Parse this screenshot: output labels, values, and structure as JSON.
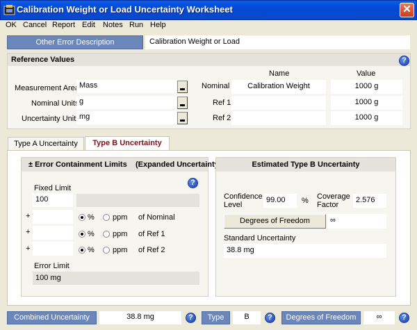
{
  "window": {
    "title": "Calibration Weight or Load Uncertainty Worksheet",
    "close_glyph": "✕"
  },
  "menu": [
    "OK",
    "Cancel",
    "Report",
    "Edit",
    "Notes",
    "Run",
    "Help"
  ],
  "error_desc": {
    "button": "Other Error Description",
    "value": "Calibration Weight or Load"
  },
  "reference": {
    "heading": "Reference Values",
    "col_name": "Name",
    "col_value": "Value",
    "rows": [
      {
        "label": "Measurement Area",
        "value": "Mass",
        "ref_label": "Nominal",
        "name": "Calibration Weight",
        "ref_value": "1000 g"
      },
      {
        "label": "Nominal Units",
        "value": "g",
        "ref_label": "Ref 1",
        "name": "",
        "ref_value": "1000 g"
      },
      {
        "label": "Uncertainty Units",
        "value": "mg",
        "ref_label": "Ref 2",
        "name": "",
        "ref_value": "1000 g"
      }
    ]
  },
  "tabs": [
    "Type A Uncertainty",
    "Type B Uncertainty"
  ],
  "limits": {
    "heading": "± Error Containment Limits",
    "heading2": "(Expanded Uncertainty)",
    "fixed_label": "Fixed Limit",
    "fixed_value": "100",
    "plus": "+",
    "pct": "%",
    "ppm": "ppm",
    "rows": [
      {
        "of": "of Nominal",
        "unit": "pct"
      },
      {
        "of": "of Ref 1",
        "unit": "pct"
      },
      {
        "of": "of Ref 2",
        "unit": "pct"
      }
    ],
    "error_label": "Error Limit",
    "error_value": "100 mg"
  },
  "estimated": {
    "heading": "Estimated Type B Uncertainty",
    "conf_label_1": "Confidence",
    "conf_label_2": "Level",
    "conf_value": "99.00",
    "pct": "%",
    "cov_label_1": "Coverage",
    "cov_label_2": "Factor",
    "cov_value": "2.576",
    "dof_button": "Degrees of Freedom",
    "dof_value": "∞",
    "std_label": "Standard Uncertainty",
    "std_value": "38.8 mg"
  },
  "footer": {
    "combined_label": "Combined Uncertainty",
    "combined_value": "38.8 mg",
    "type_label": "Type",
    "type_value": "B",
    "dof_label": "Degrees of Freedom",
    "dof_value": "∞"
  },
  "help_glyph": "?",
  "colors": {
    "title_bar": "#0348d6",
    "button_blue": "#6b86b8",
    "active_tab_text": "#7a1418",
    "help_icon": "#1a3fa8"
  }
}
